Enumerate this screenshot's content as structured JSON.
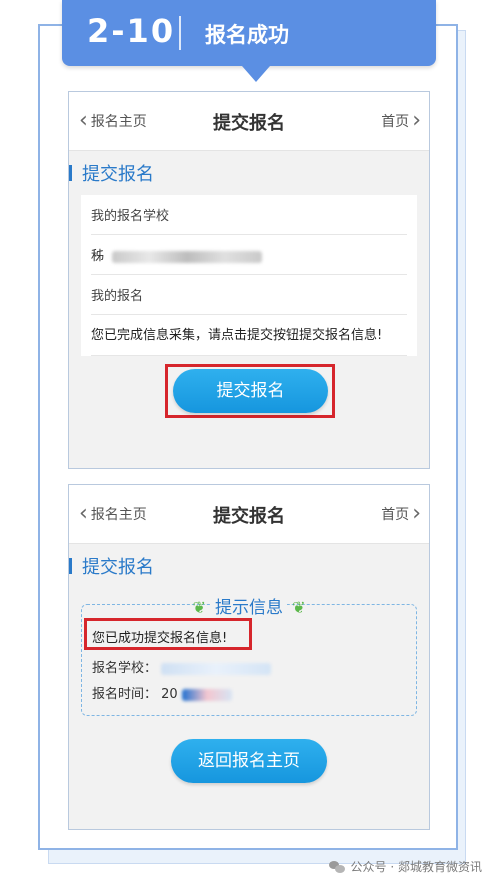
{
  "header": {
    "step": "2-10",
    "title": "报名成功"
  },
  "screen1": {
    "nav": {
      "back_label": "报名主页",
      "title": "提交报名",
      "home_label": "首页"
    },
    "section_title": "提交报名",
    "school_label": "我的报名学校",
    "school_value_visible": "秭",
    "my_registration_label": "我的报名",
    "notice": "您已完成信息采集，请点击提交按钮提交报名信息!",
    "submit_button": "提交报名"
  },
  "screen2": {
    "nav": {
      "back_label": "报名主页",
      "title": "提交报名",
      "home_label": "首页"
    },
    "section_title": "提交报名",
    "tip_title": "提示信息",
    "success_message": "您已成功提交报名信息!",
    "school_label": "报名学校：",
    "time_label": "报名时间：",
    "time_value_visible": "20",
    "return_button": "返回报名主页"
  },
  "watermark": {
    "text": "公众号 · 郯城教育微资讯",
    "icon": "wechat-icon"
  },
  "colors": {
    "header_blue": "#5b8fe3",
    "accent_blue": "#2a7ac9",
    "button_blue": "#1d9fe6",
    "highlight_red": "#d6262c",
    "leaf_green": "#5cb84a"
  }
}
